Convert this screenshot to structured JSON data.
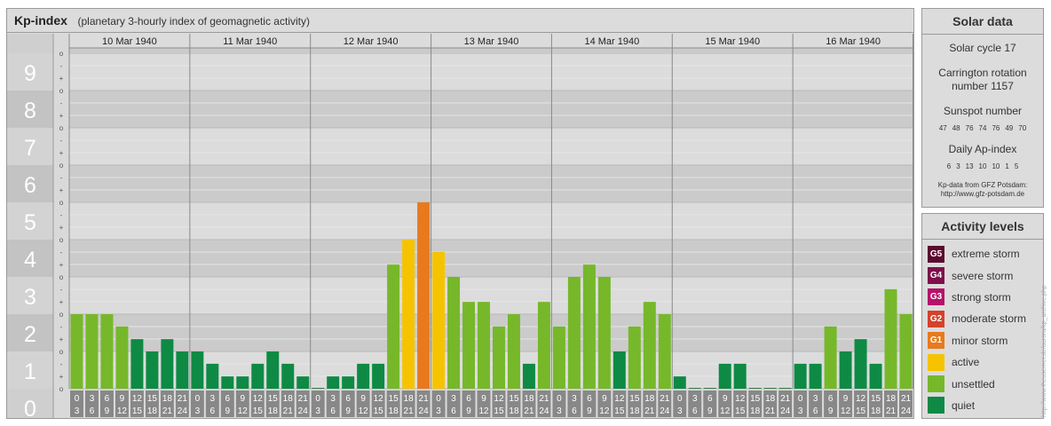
{
  "title": {
    "main": "Kp-index",
    "subtitle": "(planetary 3-hourly index of geomagnetic activity)"
  },
  "chart_data": {
    "type": "bar",
    "days": [
      "10 Mar 1940",
      "11 Mar 1940",
      "12 Mar 1940",
      "13 Mar 1940",
      "14 Mar 1940",
      "15 Mar 1940",
      "16 Mar 1940"
    ],
    "intervals": [
      [
        "0",
        "3"
      ],
      [
        "3",
        "6"
      ],
      [
        "6",
        "9"
      ],
      [
        "9",
        "12"
      ],
      [
        "12",
        "15"
      ],
      [
        "15",
        "18"
      ],
      [
        "18",
        "21"
      ],
      [
        "21",
        "24"
      ]
    ],
    "ylim": [
      0,
      9
    ],
    "y_ticks": [
      "0",
      "1",
      "2",
      "3",
      "4",
      "5",
      "6",
      "7",
      "8",
      "9"
    ],
    "minor_labels": [
      "-",
      "o",
      "+"
    ],
    "values": [
      2.0,
      2.0,
      2.0,
      1.67,
      1.33,
      1.0,
      1.33,
      1.0,
      1.0,
      0.67,
      0.33,
      0.33,
      0.67,
      1.0,
      0.67,
      0.33,
      0.0,
      0.33,
      0.33,
      0.67,
      0.67,
      3.33,
      4.0,
      5.0,
      3.67,
      3.0,
      2.33,
      2.33,
      1.67,
      2.0,
      0.67,
      2.33,
      1.67,
      3.0,
      3.33,
      3.0,
      1.0,
      1.67,
      2.33,
      2.0,
      0.33,
      0.0,
      0.0,
      0.67,
      0.67,
      0.0,
      0.0,
      0.0,
      0.67,
      0.67,
      1.67,
      1.0,
      1.33,
      0.67,
      2.67,
      2.0
    ],
    "grid": true,
    "level_colors": {
      "quiet": "#0e8a45",
      "unsettled": "#76b82a",
      "active": "#f6c300",
      "minor_storm": "#e87a1d"
    }
  },
  "solar": {
    "heading": "Solar data",
    "solar_cycle": "Solar cycle 17",
    "carrington_1": "Carrington rotation",
    "carrington_2": "number 1157",
    "sunspot_label": "Sunspot number",
    "sunspot_values": [
      "47",
      "48",
      "76",
      "74",
      "76",
      "49",
      "70"
    ],
    "ap_label": "Daily Ap-index",
    "ap_values": [
      "6",
      "3",
      "13",
      "10",
      "10",
      "1",
      "5"
    ],
    "credit_1": "Kp-data from  GFZ Potsdam:",
    "credit_2": "http://www.gfz-potsdam.de"
  },
  "activity": {
    "heading": "Activity levels",
    "items": [
      {
        "badge": "G5",
        "label": "extreme storm",
        "color": "#5a0a2e"
      },
      {
        "badge": "G4",
        "label": "severe storm",
        "color": "#7d0f4a"
      },
      {
        "badge": "G3",
        "label": "strong storm",
        "color": "#b5126a"
      },
      {
        "badge": "G2",
        "label": "moderate storm",
        "color": "#d5422c"
      },
      {
        "badge": "G1",
        "label": "minor storm",
        "color": "#e87a1d"
      },
      {
        "badge": "",
        "label": "active",
        "color": "#f6c300"
      },
      {
        "badge": "",
        "label": "unsettled",
        "color": "#76b82a"
      },
      {
        "badge": "",
        "label": "quiet",
        "color": "#0e8a45"
      }
    ]
  },
  "watermark": "http://www.theusernet.de/aurora/kp_archive.php"
}
